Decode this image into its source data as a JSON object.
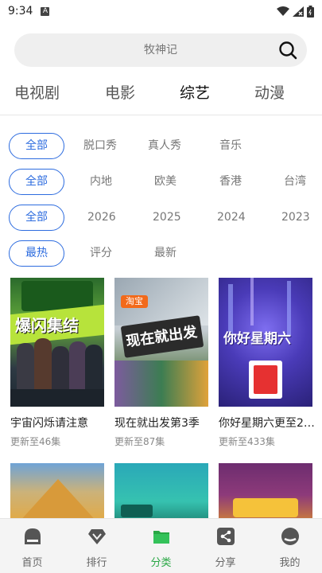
{
  "status_bar": {
    "time": "9:34",
    "notif_letter": "A"
  },
  "search": {
    "placeholder": "牧神记"
  },
  "top_tabs": [
    {
      "label": "电视剧"
    },
    {
      "label": "电影"
    },
    {
      "label": "综艺"
    },
    {
      "label": "动漫"
    }
  ],
  "filters": {
    "type": {
      "selected": "全部",
      "options": [
        "脱口秀",
        "真人秀",
        "音乐"
      ]
    },
    "region": {
      "selected": "全部",
      "options": [
        "内地",
        "欧美",
        "香港",
        "台湾"
      ]
    },
    "year": {
      "selected": "全部",
      "options": [
        "2026",
        "2025",
        "2024",
        "2023"
      ]
    },
    "sort": {
      "selected": "最热",
      "options": [
        "评分",
        "最新"
      ]
    }
  },
  "cards": [
    {
      "title": "宇宙闪烁请注意",
      "subtitle": "更新至46集",
      "poster_text": "爆闪集结"
    },
    {
      "title": "现在就出发第3季",
      "subtitle": "更新至87集",
      "poster_text": "现在就出发"
    },
    {
      "title": "你好星期六更至2…",
      "subtitle": "更新至433集",
      "poster_text": "你好星期六"
    }
  ],
  "bottom_nav": [
    {
      "label": "首页"
    },
    {
      "label": "排行"
    },
    {
      "label": "分类"
    },
    {
      "label": "分享"
    },
    {
      "label": "我的"
    }
  ],
  "colors": {
    "accent_blue": "#2d6cdf",
    "accent_green": "#29a745"
  }
}
